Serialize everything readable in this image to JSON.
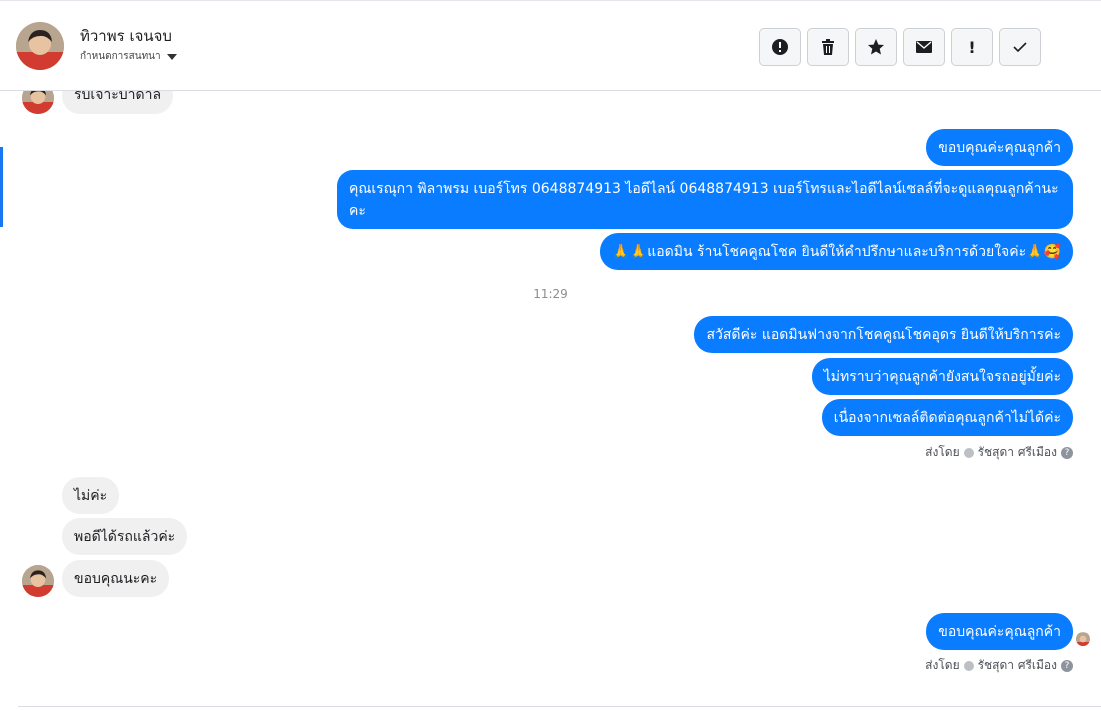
{
  "header": {
    "contact_name": "ทิวาพร เจนจบ",
    "assign_label": "กำหนดการสนทนา",
    "icons": [
      "alert-icon",
      "trash-icon",
      "star-icon",
      "envelope-icon",
      "exclamation-icon",
      "check-icon"
    ],
    "exclamation_text": "!"
  },
  "messages": {
    "partial_incoming": "รับเจาะบาดาล",
    "m1": "ขอบคุณค่ะคุณลูกค้า",
    "m2": "คุณเรณุกา พิลาพรม        เบอร์โทร 0648874913  ไอดีไลน์ 0648874913   เบอร์โทรและไอดีไลน์เซลล์ที่จะดูแลคุณลูกค้านะคะ",
    "m3": "🙏🙏แอดมิน ร้านโชคคูณโชค ยินดีให้คำปรึกษาและบริการด้วยใจค่ะ🙏🥰",
    "time": "11:29",
    "m4": "สวัสดีค่ะ แอดมินฟางจากโชคคูณโชคอุดร ยินดีให้บริการค่ะ",
    "m5": "ไม่ทราบว่าคุณลูกค้ายังสนใจรถอยู่มั้ยค่ะ",
    "m6": "เนื่องจากเซลล์ติดต่อคุณลูกค้าไม่ได้ค่ะ",
    "sent_by_prefix": "ส่งโดย",
    "sent_by_name": "รัชสุดา ศรีเมือง",
    "help_glyph": "?",
    "i1": "ไม่ค่ะ",
    "i2": "พอดีได้รถแล้วค่ะ",
    "i3": "ขอบคุณนะคะ",
    "m7": "ขอบคุณค่ะคุณลูกค้า"
  },
  "colors": {
    "outgoing_bubble": "#0a7cff",
    "incoming_bubble": "#f0f0f0",
    "accent": "#1877f2"
  }
}
